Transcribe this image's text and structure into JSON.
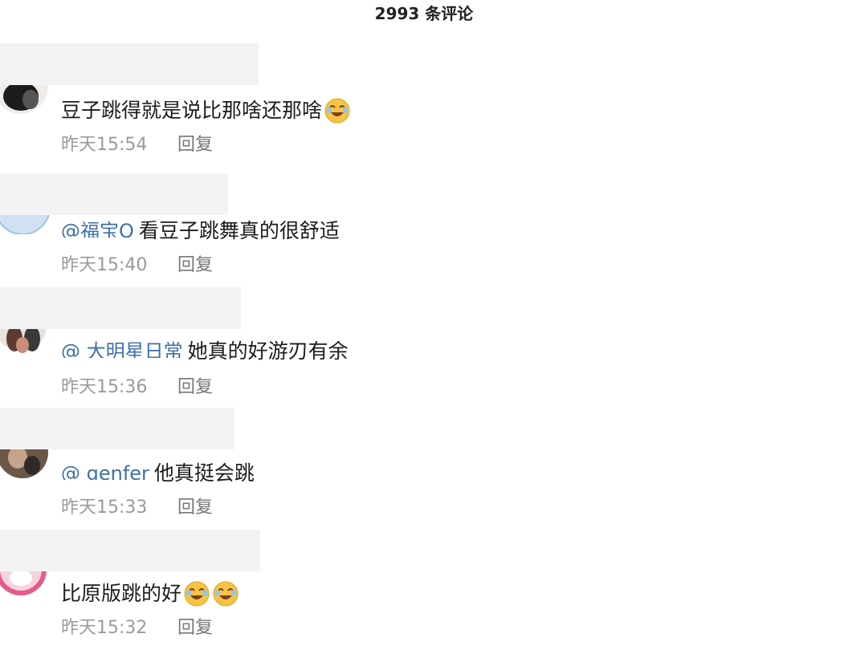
{
  "header": {
    "title": "2993 条评论"
  },
  "icons": {
    "emoji": "laughing-tears-emoji",
    "avatar": "user-avatar"
  },
  "comments": [
    {
      "text": "豆子跳得就是说比那啥还那啥",
      "time": "昨天15:54",
      "reply": "回复",
      "emojis": 1
    },
    {
      "mention": "@福宝Q",
      "text": "看豆子跳舞真的很舒适",
      "time": "昨天15:40",
      "reply": "回复",
      "emojis": 0
    },
    {
      "mention": "@ 大明星日常",
      "text": "她真的好游刃有余",
      "time": "昨天15:36",
      "reply": "回复",
      "emojis": 0
    },
    {
      "mention": "@ genfer",
      "text": "他真挺会跳",
      "time": "昨天15:33",
      "reply": "回复",
      "emojis": 0
    },
    {
      "text": "比原版跳的好",
      "time": "昨天15:32",
      "reply": "回复",
      "emojis": 2
    }
  ]
}
